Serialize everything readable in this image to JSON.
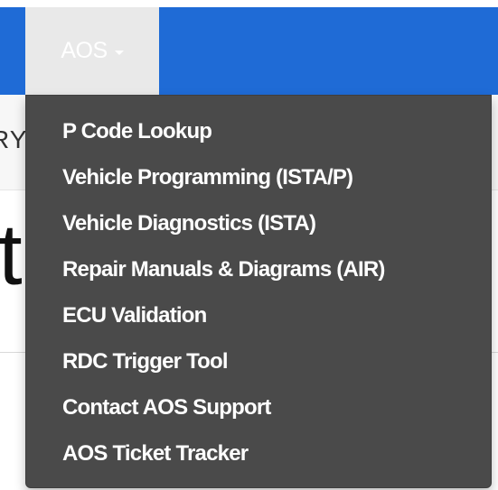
{
  "navbar": {
    "menu_label": "AOS"
  },
  "subbar": {
    "partial_text": "RY"
  },
  "main": {
    "heading_partial": "t"
  },
  "dropdown": {
    "items": [
      {
        "label": "P Code Lookup"
      },
      {
        "label": "Vehicle Programming (ISTA/P)"
      },
      {
        "label": "Vehicle Diagnostics (ISTA)"
      },
      {
        "label": "Repair Manuals & Diagrams (AIR)"
      },
      {
        "label": "ECU Validation"
      },
      {
        "label": "RDC Trigger Tool"
      },
      {
        "label": "Contact AOS Support"
      },
      {
        "label": "AOS Ticket Tracker"
      }
    ]
  },
  "colors": {
    "navbar_blue": "#1f6bd6",
    "active_tab": "#e9e9e9",
    "dropdown_bg": "#4a4a4a",
    "menu_text": "#ffffff"
  }
}
